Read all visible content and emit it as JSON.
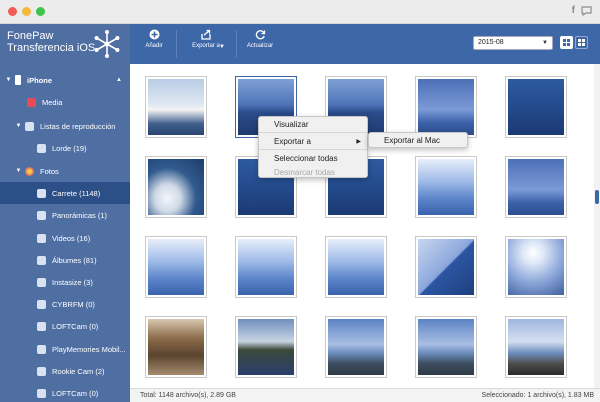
{
  "window": {
    "facebook_glyph": "f",
    "colors": {
      "accent": "#3e67a7",
      "sidebar": "#4f6fa3",
      "selected": "#2d4f87"
    }
  },
  "brand": {
    "line1": "FonePaw",
    "line2": "Transferencia iOS"
  },
  "sidebar": {
    "device": "iPhone",
    "items": [
      {
        "label": "Media",
        "icon": "music-icon"
      },
      {
        "label": "Listas de reproducción",
        "icon": "playlist-icon"
      },
      {
        "label": "Lorde (19)",
        "icon": "playlist-icon"
      },
      {
        "label": "Fotos",
        "icon": "photos-icon"
      },
      {
        "label": "Carrete (1148)",
        "icon": "album-icon"
      },
      {
        "label": "Panorámicas (1)",
        "icon": "album-icon"
      },
      {
        "label": "Videos (16)",
        "icon": "album-icon"
      },
      {
        "label": "Álbumes (81)",
        "icon": "album-icon"
      },
      {
        "label": "Instasize (3)",
        "icon": "album-icon"
      },
      {
        "label": "CYBRFM (0)",
        "icon": "album-icon"
      },
      {
        "label": "LOFTCam (0)",
        "icon": "album-icon"
      },
      {
        "label": "PlayMemories Mobil...",
        "icon": "album-icon"
      },
      {
        "label": "Rookie Cam (2)",
        "icon": "album-icon"
      },
      {
        "label": "LOFTCam (0)",
        "icon": "album-icon"
      }
    ]
  },
  "toolbar": {
    "add_label": "Añadir",
    "export_label": "Exportar a",
    "refresh_label": "Actualizar",
    "date_value": "2015-08"
  },
  "context_menu": {
    "preview": "Visualizar",
    "export_to": "Exportar a",
    "select_all": "Seleccionar todas",
    "deselect_all": "Desmarcar todas",
    "submenu_export_mac": "Exportar al Mac"
  },
  "status": {
    "total": "Total: 1148 archivo(s), 2.89 GB",
    "selected": "Seleccionado: 1 archivo(s), 1.83 MB"
  }
}
